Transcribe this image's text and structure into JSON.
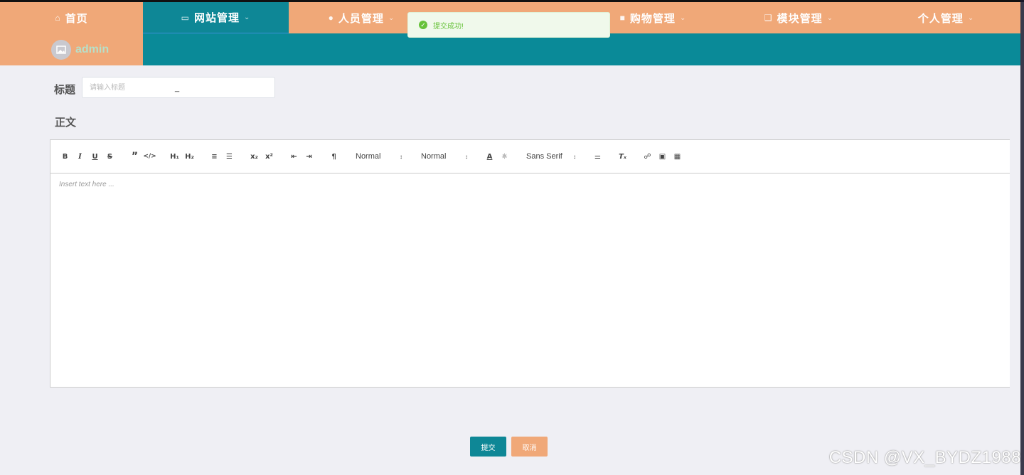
{
  "nav": {
    "items": [
      {
        "label": "首页",
        "icon": "home-icon",
        "chevron": false,
        "active": false
      },
      {
        "label": "网站管理",
        "icon": "monitor-icon",
        "chevron": true,
        "active": true
      },
      {
        "label": "人员管理",
        "icon": "user-icon",
        "chevron": true,
        "active": false
      },
      {
        "label": "",
        "icon": "",
        "chevron": false,
        "active": false
      },
      {
        "label": "购物管理",
        "icon": "bag-icon",
        "chevron": true,
        "active": false
      },
      {
        "label": "模块管理",
        "icon": "module-icon",
        "chevron": true,
        "active": false
      },
      {
        "label": "个人管理",
        "icon": "",
        "chevron": true,
        "active": false
      }
    ]
  },
  "user": {
    "name": "admin"
  },
  "toast": {
    "message": "提交成功!"
  },
  "form": {
    "title_label": "标题",
    "title_placeholder": "请输入标题",
    "title_value": "_",
    "body_label": "正文"
  },
  "editor": {
    "header_select": "Normal",
    "size_select": "Normal",
    "font_select": "Sans Serif",
    "placeholder": "Insert text here ..."
  },
  "buttons": {
    "submit": "提交",
    "cancel": "取消"
  },
  "watermark": "CSDN @VX_BYDZ1988",
  "colors": {
    "teal": "#0e8796",
    "peach": "#f0a878",
    "success": "#67c23a"
  }
}
